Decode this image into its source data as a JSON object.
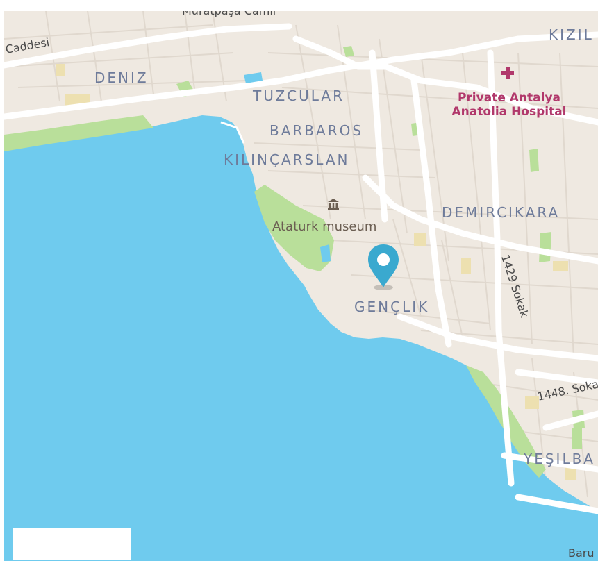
{
  "map": {
    "districts": {
      "kizil": "KIZIL",
      "deniz": "DENIZ",
      "tuzcular": "TUZCULAR",
      "barbaros": "BARBAROS",
      "kilincarslan": "KILINÇARSLAN",
      "demircikara": "DEMIRCIKARA",
      "genclik": "GENÇLIK",
      "yesilba": "YEŞILBA"
    },
    "streets": {
      "caddesi": "Caddesi",
      "muratpasa": "Muratpaşa Camii",
      "sokak_1429": "1429 Sokak",
      "sokak_1448": "1448. Soka",
      "baru": "Baru"
    },
    "pois": {
      "hospital": {
        "line1": "Private Antalya",
        "line2": "Anatolia Hospital",
        "icon": "hospital-cross-icon",
        "color": "#b1386b"
      },
      "museum": {
        "label": "Ataturk museum",
        "icon": "museum-icon"
      }
    },
    "marker": {
      "icon": "location-pin-icon",
      "color": "#3aa9cf"
    },
    "colors": {
      "water": "#6fcbee",
      "land": "#efe9e1",
      "park": "#b9df9a",
      "road": "#ffffff",
      "district_text": "#6e7b9a"
    }
  }
}
